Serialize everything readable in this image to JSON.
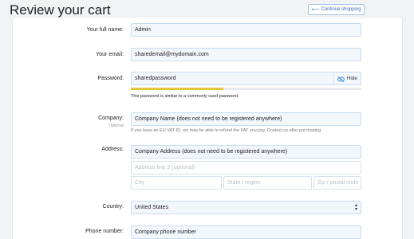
{
  "header": {
    "title": "Review your cart",
    "continue_label": "Continue shopping"
  },
  "form": {
    "full_name": {
      "label": "Your full name:",
      "value": "Admin"
    },
    "email": {
      "label": "Your email:",
      "value": "sharedemail@mydomain.com"
    },
    "password": {
      "label": "Password:",
      "value": "sharedpassword",
      "toggle_label": "Hide",
      "strength_fraction": 0.4,
      "strength_color": "#e1c63d",
      "hint": "This password is similar to a commonly used password."
    },
    "company": {
      "label": "Company:",
      "optional": "Optional",
      "placeholder": "Company Name (does not need to be registered anywhere)",
      "hint": "If you have an EU VAT ID, we may be able to refund the VAT you pay. Contact us after purchasing."
    },
    "address": {
      "label": "Address:",
      "line1_placeholder": "Company Address (does not need to be registered anywhere)",
      "line2_placeholder": "Address line 2 (optional)",
      "city_placeholder": "City",
      "state_placeholder": "State / region",
      "zip_placeholder": "Zip / postal code"
    },
    "country": {
      "label": "Country:",
      "value": "United States"
    },
    "phone": {
      "label": "Phone number:",
      "placeholder": "Company phone number"
    }
  },
  "colors": {
    "accent": "#2f6fb5",
    "field_bg": "#f2f7fc",
    "field_border": "#c9ddf0"
  }
}
